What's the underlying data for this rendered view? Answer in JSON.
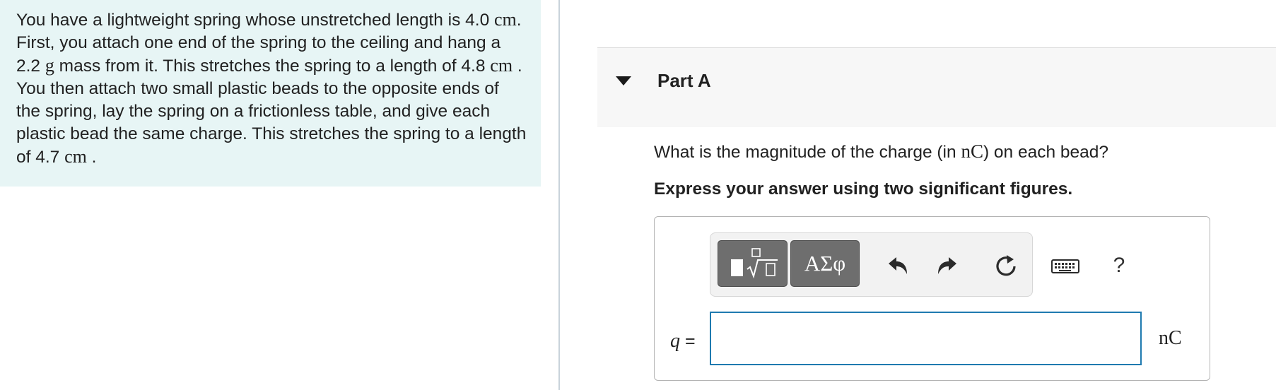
{
  "problem": {
    "s1": "You have a lightweight spring whose unstretched length is 4.0 ",
    "u1": "cm",
    "s2": ". First, you attach one end of the spring to the ceiling and hang a 2.2 ",
    "u2": "g",
    "s3": " mass from it. This stretches the spring to a length of 4.8 ",
    "u3": "cm",
    "s4": " . You then attach two small plastic beads to the opposite ends of the spring, lay the spring on a frictionless table, and give each plastic bead the same charge. This stretches the spring to a length of 4.7 ",
    "u4": "cm",
    "s5": " ."
  },
  "part": {
    "title": "Part A"
  },
  "question": {
    "pre": "What is the magnitude of the charge (in ",
    "unit": "nC",
    "post": ") on each bead?"
  },
  "instruction": "Express your answer using two significant figures.",
  "toolbar": {
    "templates_icon": "fraction-radical-templates-icon",
    "greek_label": "ΑΣφ",
    "undo_icon": "undo-icon",
    "redo_icon": "redo-icon",
    "reset_icon": "reset-icon",
    "keyboard_icon": "keyboard-icon",
    "help_label": "?"
  },
  "answer": {
    "variable": "q",
    "equals": " =",
    "value": "",
    "unit": "nC"
  },
  "colors": {
    "problem_bg": "#e7f5f5",
    "header_bg": "#f7f7f7",
    "input_border": "#1f7ab0",
    "toolbar_button": "#6e6e6e"
  }
}
